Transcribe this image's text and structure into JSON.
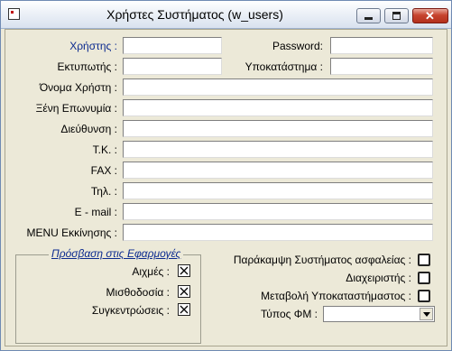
{
  "window": {
    "title": "Χρήστες Συστήματος    (w_users)"
  },
  "form": {
    "user_label": "Χρήστης :",
    "user_value": "",
    "password_label": "Password:",
    "password_value": "",
    "printer_label": "Εκτυπωτής :",
    "printer_value": "",
    "branch_label": "Υποκατάστημα :",
    "branch_value": "",
    "username_label": "Όνομα Χρήστη :",
    "username_value": "",
    "foreign_surname_label": "Ξένη Επωνυμία :",
    "foreign_surname_value": "",
    "address_label": "Διεύθυνση :",
    "address_value": "",
    "postal_label": "Τ.Κ. :",
    "postal_value": "",
    "fax_label": "FAX :",
    "fax_value": "",
    "phone_label": "Τηλ. :",
    "phone_value": "",
    "email_label": "E - mail :",
    "email_value": "",
    "menu_label": "MENU Εκκίνησης :",
    "menu_value": ""
  },
  "access_group": {
    "title": "Πρόσβαση στις Εφαρμογές",
    "items": [
      {
        "label": "Αιχμές :",
        "checked": true
      },
      {
        "label": "Μισθοδοσία :",
        "checked": true
      },
      {
        "label": "Συγκεντρώσεις :",
        "checked": true
      }
    ]
  },
  "options": {
    "bypass_label": "Παράκαμψη Συστήματος ασφαλείας :",
    "bypass_checked": false,
    "admin_label": "Διαχειριστής :",
    "admin_checked": false,
    "branch_change_label": "Μεταβολή Υποκαταστήμαστος :",
    "branch_change_checked": false,
    "fm_type_label": "Τύπος ΦΜ :",
    "fm_type_value": ""
  }
}
